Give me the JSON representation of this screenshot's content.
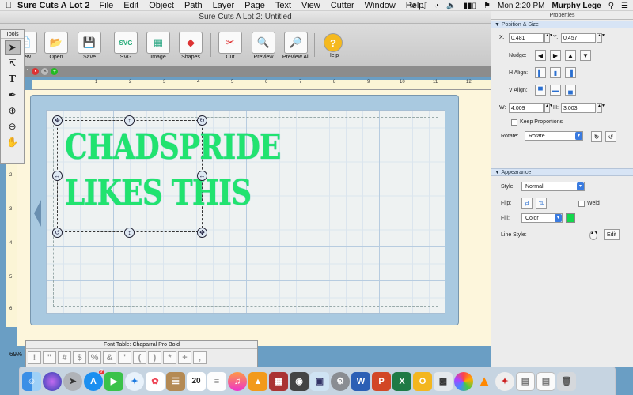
{
  "menubar": {
    "app": "Sure Cuts A Lot 2",
    "items": [
      "File",
      "Edit",
      "Object",
      "Path",
      "Layer",
      "Page",
      "Text",
      "View",
      "Cutter",
      "Window",
      "Help"
    ],
    "clock": "Mon 2:20 PM",
    "user": "Murphy Lege"
  },
  "window": {
    "title": "Sure Cuts A Lot 2: Untitled"
  },
  "toolbar": {
    "buttons": [
      {
        "label": "New",
        "icon": "new-doc-icon"
      },
      {
        "label": "Open",
        "icon": "open-folder-icon"
      },
      {
        "label": "Save",
        "icon": "floppy-icon"
      },
      {
        "label": "SVG",
        "icon": "svg-import-icon"
      },
      {
        "label": "Image",
        "icon": "image-import-icon"
      },
      {
        "label": "Shapes",
        "icon": "shapes-icon"
      },
      {
        "label": "Cut",
        "icon": "scissors-icon"
      },
      {
        "label": "Preview",
        "icon": "preview-icon"
      },
      {
        "label": "Preview All",
        "icon": "preview-all-icon"
      },
      {
        "label": "Help",
        "icon": "help-icon"
      }
    ]
  },
  "tools": {
    "title": "Tools",
    "items": [
      "select-arrow-icon",
      "node-edit-icon",
      "text-tool-icon",
      "pen-tool-icon",
      "zoom-in-icon",
      "zoom-out-icon",
      "hand-pan-icon"
    ]
  },
  "doctabs": {
    "page_number": "1"
  },
  "ruler": {
    "h": [
      "1",
      "2",
      "3",
      "4",
      "5",
      "6",
      "7",
      "8",
      "9",
      "10",
      "11",
      "12"
    ],
    "v": [
      "1",
      "2",
      "3",
      "4",
      "5",
      "6"
    ]
  },
  "design": {
    "line1": "CHADSPRIDE",
    "line2": "LIKES THIS",
    "color": "#21e36f"
  },
  "zoom": "69%",
  "font_table": {
    "title": "Font Table: Chaparral Pro Bold",
    "glyphs": [
      "!",
      "\"",
      "#",
      "$",
      "%",
      "&",
      "'",
      "(",
      ")",
      "*",
      "+",
      ","
    ]
  },
  "properties": {
    "title": "Properties",
    "position_size": {
      "header": "Position & Size",
      "x_label": "X:",
      "x": "0.481",
      "y_label": "Y:",
      "y": "0.457",
      "nudge_label": "Nudge:",
      "halign_label": "H Align:",
      "valign_label": "V Align:",
      "w_label": "W:",
      "w": "4.009",
      "h_label": "H:",
      "h": "3.003",
      "keep_proportions": "Keep Proportions",
      "rotate_label": "Rotate:",
      "rotate": "Rotate"
    },
    "appearance": {
      "header": "Appearance",
      "style_label": "Style:",
      "style": "Normal",
      "flip_label": "Flip:",
      "weld": "Weld",
      "fill_label": "Fill:",
      "fill": "Color",
      "fill_color": "#13d84c",
      "line_style_label": "Line Style:",
      "edit": "Edit"
    }
  },
  "dock": {
    "calendar_day": "20",
    "appstore_badge": "7",
    "apps": [
      "finder-icon",
      "siri-icon",
      "launchpad-icon",
      "app-store-icon",
      "facetime-icon",
      "safari-icon",
      "photos-icon",
      "notes-icon",
      "calendar-icon",
      "notes-list-icon",
      "itunes-icon",
      "ibooks-icon",
      "app-icon-1",
      "app-icon-2",
      "preview-app-icon",
      "system-prefs-icon",
      "word-icon",
      "powerpoint-icon",
      "excel-icon",
      "outlook-icon",
      "app-icon-3",
      "photos-wheel-icon",
      "vlc-icon",
      "safari-compass-icon",
      "document-icon",
      "document-icon-2",
      "trash-icon"
    ]
  }
}
